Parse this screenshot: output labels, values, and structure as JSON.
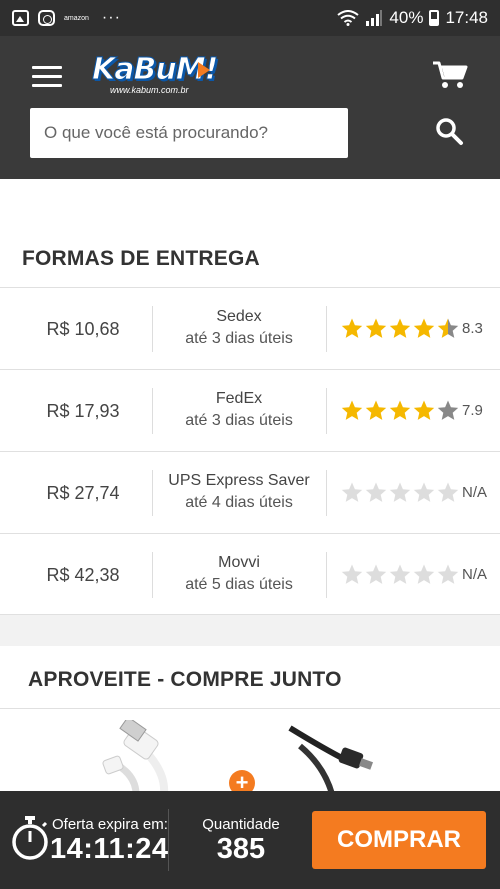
{
  "status_bar": {
    "icons": [
      "image-icon",
      "instagram-icon",
      "amazon-icon"
    ],
    "amazon_text": "amazon",
    "dots": "···",
    "battery": "40%",
    "time": "17:48"
  },
  "header": {
    "logo_text": "KaBuM!",
    "logo_sub": "www.kabum.com.br",
    "search_placeholder": "O que você está procurando?"
  },
  "shipping": {
    "title": "FORMAS DE ENTREGA",
    "options": [
      {
        "price": "R$ 10,68",
        "carrier": "Sedex",
        "eta": "até 3 dias úteis",
        "stars": 4.5,
        "rating": "8.3"
      },
      {
        "price": "R$ 17,93",
        "carrier": "FedEx",
        "eta": "até 3 dias úteis",
        "stars": 4,
        "rating": "7.9"
      },
      {
        "price": "R$ 27,74",
        "carrier": "UPS Express Saver",
        "eta": "até 4 dias úteis",
        "stars": 0,
        "rating": "N/A"
      },
      {
        "price": "R$ 42,38",
        "carrier": "Movvi",
        "eta": "até 5 dias úteis",
        "stars": 0,
        "rating": "N/A"
      }
    ]
  },
  "combo": {
    "title": "APROVEITE - COMPRE JUNTO",
    "plus": "+"
  },
  "bottom_bar": {
    "offer_label": "Oferta expira em:",
    "offer_time": "14:11:24",
    "qty_label": "Quantidade",
    "qty_value": "385",
    "buy_label": "COMPRAR"
  },
  "colors": {
    "accent": "#f47b20",
    "star_filled": "#f5b800",
    "star_empty": "#dddddd",
    "star_gray": "#888888",
    "header_bg": "#3a3a3a"
  }
}
